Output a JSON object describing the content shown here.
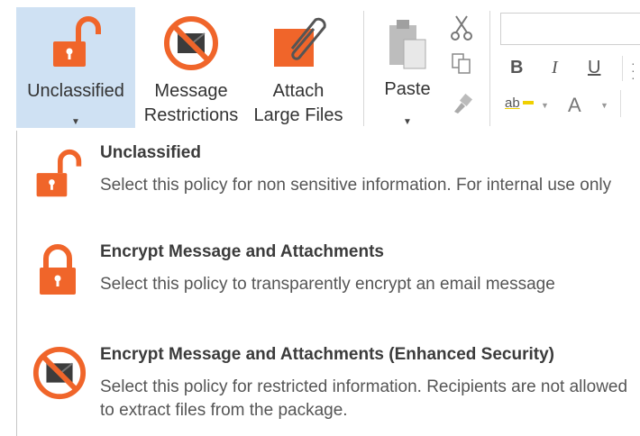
{
  "ribbon": {
    "unclassified_label": "Unclassified",
    "restrictions_line1": "Message",
    "restrictions_line2": "Restrictions",
    "attach_line1": "Attach",
    "attach_line2": "Large Files",
    "paste_label": "Paste",
    "bold_label": "B",
    "italic_label": "I",
    "underline_label": "U",
    "font_color_label": "A",
    "highlight_label": "ab",
    "accent_color": "#f0652a",
    "selected_bg": "#cfe1f3"
  },
  "menu": {
    "items": [
      {
        "icon": "unlocked-padlock-icon",
        "title": "Unclassified",
        "description": "Select this policy for non sensitive information.  For internal use only"
      },
      {
        "icon": "locked-padlock-icon",
        "title": "Encrypt Message and Attachments",
        "description": "Select this policy to transparently encrypt an email message"
      },
      {
        "icon": "restricted-envelope-icon",
        "title": "Encrypt Message and Attachments (Enhanced Security)",
        "description": "Select this policy for restricted information. Recipients are not allowed to extract files from the package."
      }
    ]
  }
}
